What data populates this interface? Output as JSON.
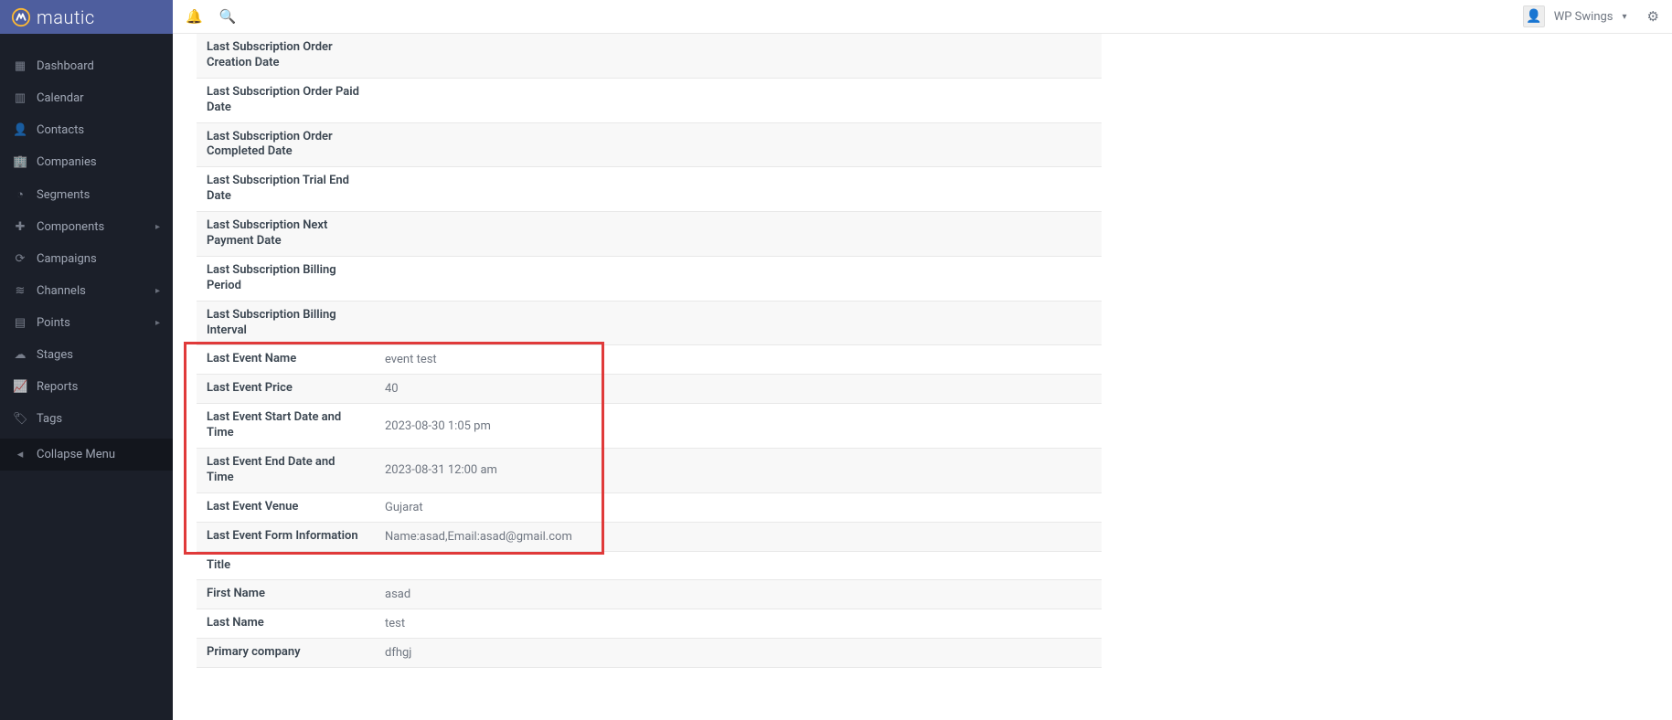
{
  "brand": "mautic",
  "sidebar": {
    "items": [
      {
        "icon": "▦",
        "label": "Dashboard"
      },
      {
        "icon": "▥",
        "label": "Calendar"
      },
      {
        "icon": "👤",
        "label": "Contacts"
      },
      {
        "icon": "🏢",
        "label": "Companies"
      },
      {
        "icon": "◔",
        "label": "Segments"
      },
      {
        "icon": "✚",
        "label": "Components",
        "expand": true
      },
      {
        "icon": "⟳",
        "label": "Campaigns"
      },
      {
        "icon": "≋",
        "label": "Channels",
        "expand": true
      },
      {
        "icon": "▤",
        "label": "Points",
        "expand": true
      },
      {
        "icon": "☁",
        "label": "Stages"
      },
      {
        "icon": "📈",
        "label": "Reports"
      },
      {
        "icon": "🏷",
        "label": "Tags"
      }
    ],
    "collapse": "Collapse Menu"
  },
  "user": {
    "name": "WP Swings"
  },
  "details": [
    {
      "label": "Last Subscription Order Creation Date",
      "value": ""
    },
    {
      "label": "Last Subscription Order Paid Date",
      "value": ""
    },
    {
      "label": "Last Subscription Order Completed Date",
      "value": ""
    },
    {
      "label": "Last Subscription Trial End Date",
      "value": ""
    },
    {
      "label": "Last Subscription Next Payment Date",
      "value": ""
    },
    {
      "label": "Last Subscription Billing Period",
      "value": ""
    },
    {
      "label": "Last Subscription Billing Interval",
      "value": ""
    },
    {
      "label": "Last Event Name",
      "value": "event test"
    },
    {
      "label": "Last Event Price",
      "value": "40"
    },
    {
      "label": "Last Event Start Date and Time",
      "value": "2023-08-30 1:05 pm"
    },
    {
      "label": "Last Event End Date and Time",
      "value": "2023-08-31 12:00 am"
    },
    {
      "label": "Last Event Venue",
      "value": "Gujarat"
    },
    {
      "label": "Last Event Form Information",
      "value": "Name:asad,Email:asad@gmail.com"
    },
    {
      "label": "Title",
      "value": ""
    },
    {
      "label": "First Name",
      "value": "asad"
    },
    {
      "label": "Last Name",
      "value": "test"
    },
    {
      "label": "Primary company",
      "value": "dfhgj"
    }
  ]
}
